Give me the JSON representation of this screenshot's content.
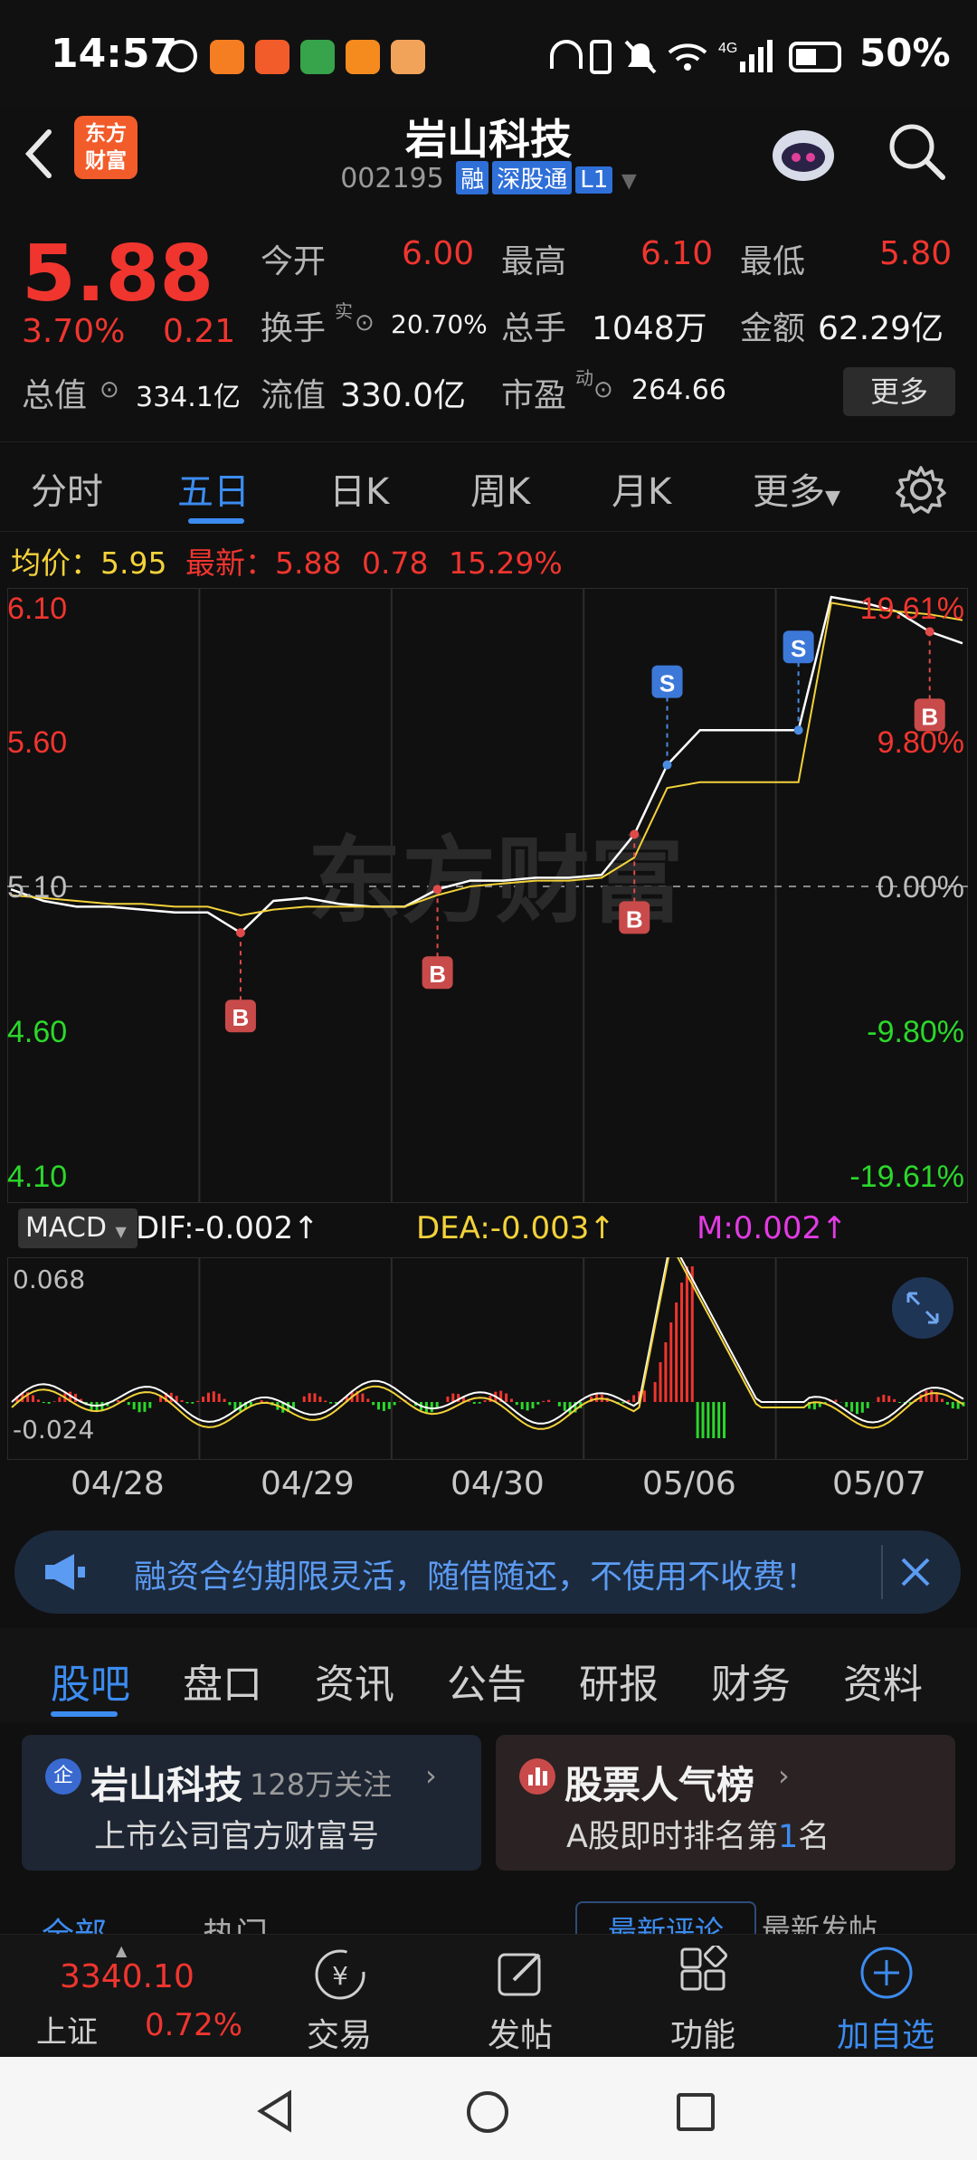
{
  "status": {
    "time": "14:57",
    "battery": "50%"
  },
  "header": {
    "title": "岩山科技",
    "code": "002195",
    "tags": [
      "融",
      "深股通",
      "L1"
    ],
    "logo_line1": "东方",
    "logo_line2": "财富"
  },
  "quote": {
    "price": "5.88",
    "change_pct": "3.70%",
    "change": "0.21",
    "open_label": "今开",
    "open": "6.00",
    "high_label": "最高",
    "high": "6.10",
    "low_label": "最低",
    "low": "5.80",
    "turnover_label": "换手",
    "turnover_sup": "实",
    "turnover": "20.70%",
    "volume_label": "总手",
    "volume": "1048万",
    "amount_label": "金额",
    "amount": "62.29亿",
    "mktcap_label": "总值",
    "mktcap": "334.1亿",
    "float_label": "流值",
    "float": "330.0亿",
    "pe_label": "市盈",
    "pe_sup": "动",
    "pe": "264.66",
    "more": "更多"
  },
  "period_tabs": [
    "分时",
    "五日",
    "日K",
    "周K",
    "月K",
    "更多"
  ],
  "active_period": 1,
  "chart_info": {
    "avg_label": "均价：",
    "avg": "5.95",
    "latest_label": "最新：",
    "latest": "5.88",
    "latest_chg": "0.78",
    "latest_pct": "15.29%"
  },
  "chart_data": {
    "type": "line",
    "y_ticks": [
      "6.10",
      "5.60",
      "5.10",
      "4.60",
      "4.10"
    ],
    "pct_ticks": [
      "19.61%",
      "9.80%",
      "0.00%",
      "-9.80%",
      "-19.61%"
    ],
    "ylim": [
      4.1,
      6.1
    ],
    "x_dates": [
      "04/28",
      "04/29",
      "04/30",
      "05/06",
      "05/07"
    ],
    "series": [
      {
        "name": "price",
        "color": "#ffffff",
        "values": [
          5.09,
          5.05,
          5.03,
          5.03,
          5.02,
          5.01,
          5.01,
          4.94,
          5.05,
          5.06,
          5.04,
          5.03,
          5.03,
          5.09,
          5.12,
          5.12,
          5.13,
          5.13,
          5.14,
          5.28,
          5.52,
          5.64,
          5.64,
          5.64,
          5.64,
          6.1,
          6.08,
          6.05,
          5.98,
          5.94
        ]
      },
      {
        "name": "avg",
        "color": "#f3d23a",
        "values": [
          5.07,
          5.06,
          5.05,
          5.04,
          5.04,
          5.03,
          5.03,
          5.0,
          5.02,
          5.03,
          5.03,
          5.03,
          5.03,
          5.07,
          5.1,
          5.11,
          5.12,
          5.12,
          5.13,
          5.2,
          5.44,
          5.46,
          5.46,
          5.46,
          5.46,
          6.08,
          6.06,
          6.05,
          6.04,
          6.02
        ]
      }
    ],
    "marks": [
      "B",
      "B",
      "B",
      "S",
      "S",
      "B"
    ]
  },
  "macd": {
    "selector": "MACD",
    "dif": "DIF:-0.002↑",
    "dea": "DEA:-0.003↑",
    "m": "M:0.002↑",
    "top": "0.068",
    "bottom": "-0.024"
  },
  "watermark": "东方财富",
  "banner": {
    "text": "融资合约期限灵活，随借随还，不使用不收费！"
  },
  "section_tabs": [
    "股吧",
    "盘口",
    "资讯",
    "公告",
    "研报",
    "财务",
    "资料"
  ],
  "cards": {
    "left_icon": "企",
    "left_title": "岩山科技",
    "left_follow": "128万关注",
    "left_sub": "上市公司官方财富号",
    "right_title": "股票人气榜",
    "right_sub_a": "A股即时排名第",
    "right_rank": "1",
    "right_sub_b": "名"
  },
  "partial_tabs": [
    "全部",
    "热门",
    "最新评论",
    "最新发帖"
  ],
  "bottom_nav": {
    "index_value": "3340.10",
    "index_name": "上证",
    "index_pct": "0.72%",
    "trade": "交易",
    "post": "发帖",
    "func": "功能",
    "add": "加自选"
  },
  "colors": {
    "up": "#f0352f",
    "down": "#2bd82b",
    "accent": "#3c8cf0",
    "avg_line": "#f3d23a"
  }
}
